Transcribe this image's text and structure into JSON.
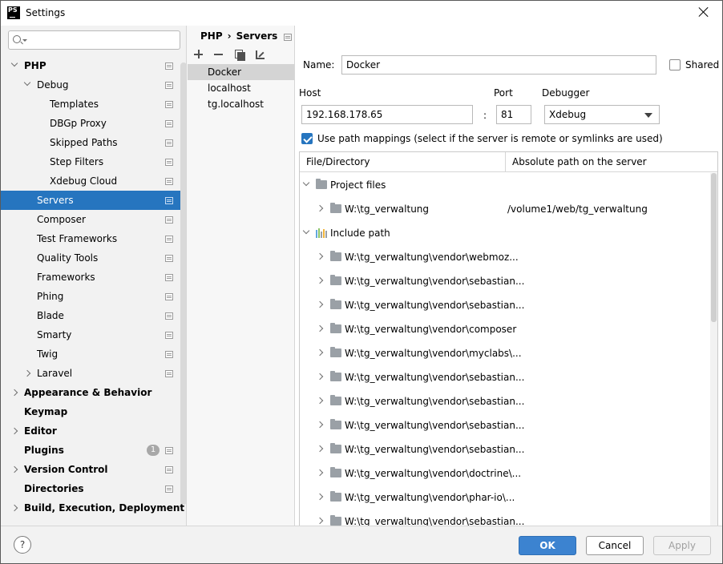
{
  "window": {
    "title": "Settings",
    "app_icon_label": "PS"
  },
  "search": {
    "placeholder": ""
  },
  "sidebar": {
    "items": [
      {
        "label": "PHP",
        "level": 0,
        "bold": true,
        "chevron": "down",
        "proj_icon": true
      },
      {
        "label": "Debug",
        "level": 1,
        "bold": false,
        "chevron": "down",
        "proj_icon": true
      },
      {
        "label": "Templates",
        "level": 2,
        "bold": false,
        "chevron": "",
        "proj_icon": true
      },
      {
        "label": "DBGp Proxy",
        "level": 2,
        "bold": false,
        "chevron": "",
        "proj_icon": true
      },
      {
        "label": "Skipped Paths",
        "level": 2,
        "bold": false,
        "chevron": "",
        "proj_icon": true
      },
      {
        "label": "Step Filters",
        "level": 2,
        "bold": false,
        "chevron": "",
        "proj_icon": true
      },
      {
        "label": "Xdebug Cloud",
        "level": 2,
        "bold": false,
        "chevron": "",
        "proj_icon": true
      },
      {
        "label": "Servers",
        "level": 1,
        "bold": false,
        "chevron": "",
        "proj_icon": true,
        "selected": true
      },
      {
        "label": "Composer",
        "level": 1,
        "bold": false,
        "chevron": "",
        "proj_icon": true
      },
      {
        "label": "Test Frameworks",
        "level": 1,
        "bold": false,
        "chevron": "",
        "proj_icon": true
      },
      {
        "label": "Quality Tools",
        "level": 1,
        "bold": false,
        "chevron": "",
        "proj_icon": true
      },
      {
        "label": "Frameworks",
        "level": 1,
        "bold": false,
        "chevron": "",
        "proj_icon": true
      },
      {
        "label": "Phing",
        "level": 1,
        "bold": false,
        "chevron": "",
        "proj_icon": true
      },
      {
        "label": "Blade",
        "level": 1,
        "bold": false,
        "chevron": "",
        "proj_icon": true
      },
      {
        "label": "Smarty",
        "level": 1,
        "bold": false,
        "chevron": "",
        "proj_icon": true
      },
      {
        "label": "Twig",
        "level": 1,
        "bold": false,
        "chevron": "",
        "proj_icon": true
      },
      {
        "label": "Laravel",
        "level": 1,
        "bold": false,
        "chevron": "right",
        "proj_icon": true
      },
      {
        "label": "Appearance & Behavior",
        "level": 0,
        "bold": true,
        "chevron": "right",
        "proj_icon": false
      },
      {
        "label": "Keymap",
        "level": 0,
        "bold": true,
        "chevron": "",
        "proj_icon": false
      },
      {
        "label": "Editor",
        "level": 0,
        "bold": true,
        "chevron": "right",
        "proj_icon": false
      },
      {
        "label": "Plugins",
        "level": 0,
        "bold": true,
        "chevron": "",
        "proj_icon": true,
        "badge": "1"
      },
      {
        "label": "Version Control",
        "level": 0,
        "bold": true,
        "chevron": "right",
        "proj_icon": true
      },
      {
        "label": "Directories",
        "level": 0,
        "bold": true,
        "chevron": "",
        "proj_icon": true
      },
      {
        "label": "Build, Execution, Deployment",
        "level": 0,
        "bold": true,
        "chevron": "right",
        "proj_icon": false
      }
    ]
  },
  "breadcrumb": {
    "parent": "PHP",
    "separator": "›",
    "current": "Servers"
  },
  "servers": {
    "items": [
      {
        "label": "Docker",
        "selected": true
      },
      {
        "label": "localhost",
        "selected": false
      },
      {
        "label": "tg.localhost",
        "selected": false
      }
    ]
  },
  "form": {
    "name_label": "Name:",
    "name_value": "Docker",
    "shared_label": "Shared",
    "shared_checked": false,
    "host_label": "Host",
    "host_value": "192.168.178.65",
    "colon": ":",
    "port_label": "Port",
    "port_value": "81",
    "debugger_label": "Debugger",
    "debugger_value": "Xdebug",
    "path_mappings_label": "Use path mappings (select if the server is remote or symlinks are used)",
    "path_mappings_checked": true
  },
  "mapping_table": {
    "col_file": "File/Directory",
    "col_abs": "Absolute path on the server",
    "rows": [
      {
        "type": "group",
        "icon": "folder-icon",
        "label": "Project files",
        "chevron": "down",
        "indent": 0,
        "abs": ""
      },
      {
        "type": "entry",
        "icon": "folder-icon",
        "label": "W:\\tg_verwaltung",
        "chevron": "right",
        "indent": 1,
        "abs": "/volume1/web/tg_verwaltung"
      },
      {
        "type": "group",
        "icon": "library-icon",
        "label": "Include path",
        "chevron": "down",
        "indent": 0,
        "abs": ""
      },
      {
        "type": "entry",
        "icon": "folder-icon",
        "label": "W:\\tg_verwaltung\\vendor\\webmoz...",
        "chevron": "right",
        "indent": 1,
        "abs": ""
      },
      {
        "type": "entry",
        "icon": "folder-icon",
        "label": "W:\\tg_verwaltung\\vendor\\sebastian...",
        "chevron": "right",
        "indent": 1,
        "abs": ""
      },
      {
        "type": "entry",
        "icon": "folder-icon",
        "label": "W:\\tg_verwaltung\\vendor\\sebastian...",
        "chevron": "right",
        "indent": 1,
        "abs": ""
      },
      {
        "type": "entry",
        "icon": "folder-icon",
        "label": "W:\\tg_verwaltung\\vendor\\composer",
        "chevron": "right",
        "indent": 1,
        "abs": ""
      },
      {
        "type": "entry",
        "icon": "folder-icon",
        "label": "W:\\tg_verwaltung\\vendor\\myclabs\\...",
        "chevron": "right",
        "indent": 1,
        "abs": ""
      },
      {
        "type": "entry",
        "icon": "folder-icon",
        "label": "W:\\tg_verwaltung\\vendor\\sebastian...",
        "chevron": "right",
        "indent": 1,
        "abs": ""
      },
      {
        "type": "entry",
        "icon": "folder-icon",
        "label": "W:\\tg_verwaltung\\vendor\\sebastian...",
        "chevron": "right",
        "indent": 1,
        "abs": ""
      },
      {
        "type": "entry",
        "icon": "folder-icon",
        "label": "W:\\tg_verwaltung\\vendor\\sebastian...",
        "chevron": "right",
        "indent": 1,
        "abs": ""
      },
      {
        "type": "entry",
        "icon": "folder-icon",
        "label": "W:\\tg_verwaltung\\vendor\\sebastian...",
        "chevron": "right",
        "indent": 1,
        "abs": ""
      },
      {
        "type": "entry",
        "icon": "folder-icon",
        "label": "W:\\tg_verwaltung\\vendor\\doctrine\\...",
        "chevron": "right",
        "indent": 1,
        "abs": ""
      },
      {
        "type": "entry",
        "icon": "folder-icon",
        "label": "W:\\tg_verwaltung\\vendor\\phar-io\\...",
        "chevron": "right",
        "indent": 1,
        "abs": ""
      },
      {
        "type": "entry",
        "icon": "folder-icon",
        "label": "W:\\tg_verwaltung\\vendor\\sebastian...",
        "chevron": "right",
        "indent": 1,
        "abs": ""
      }
    ]
  },
  "footer": {
    "help_label": "?",
    "ok_label": "OK",
    "cancel_label": "Cancel",
    "apply_label": "Apply"
  },
  "colors": {
    "selection": "#2675bf",
    "ok_button": "#3c83d0",
    "sidebar_bg": "#f2f2f2"
  }
}
